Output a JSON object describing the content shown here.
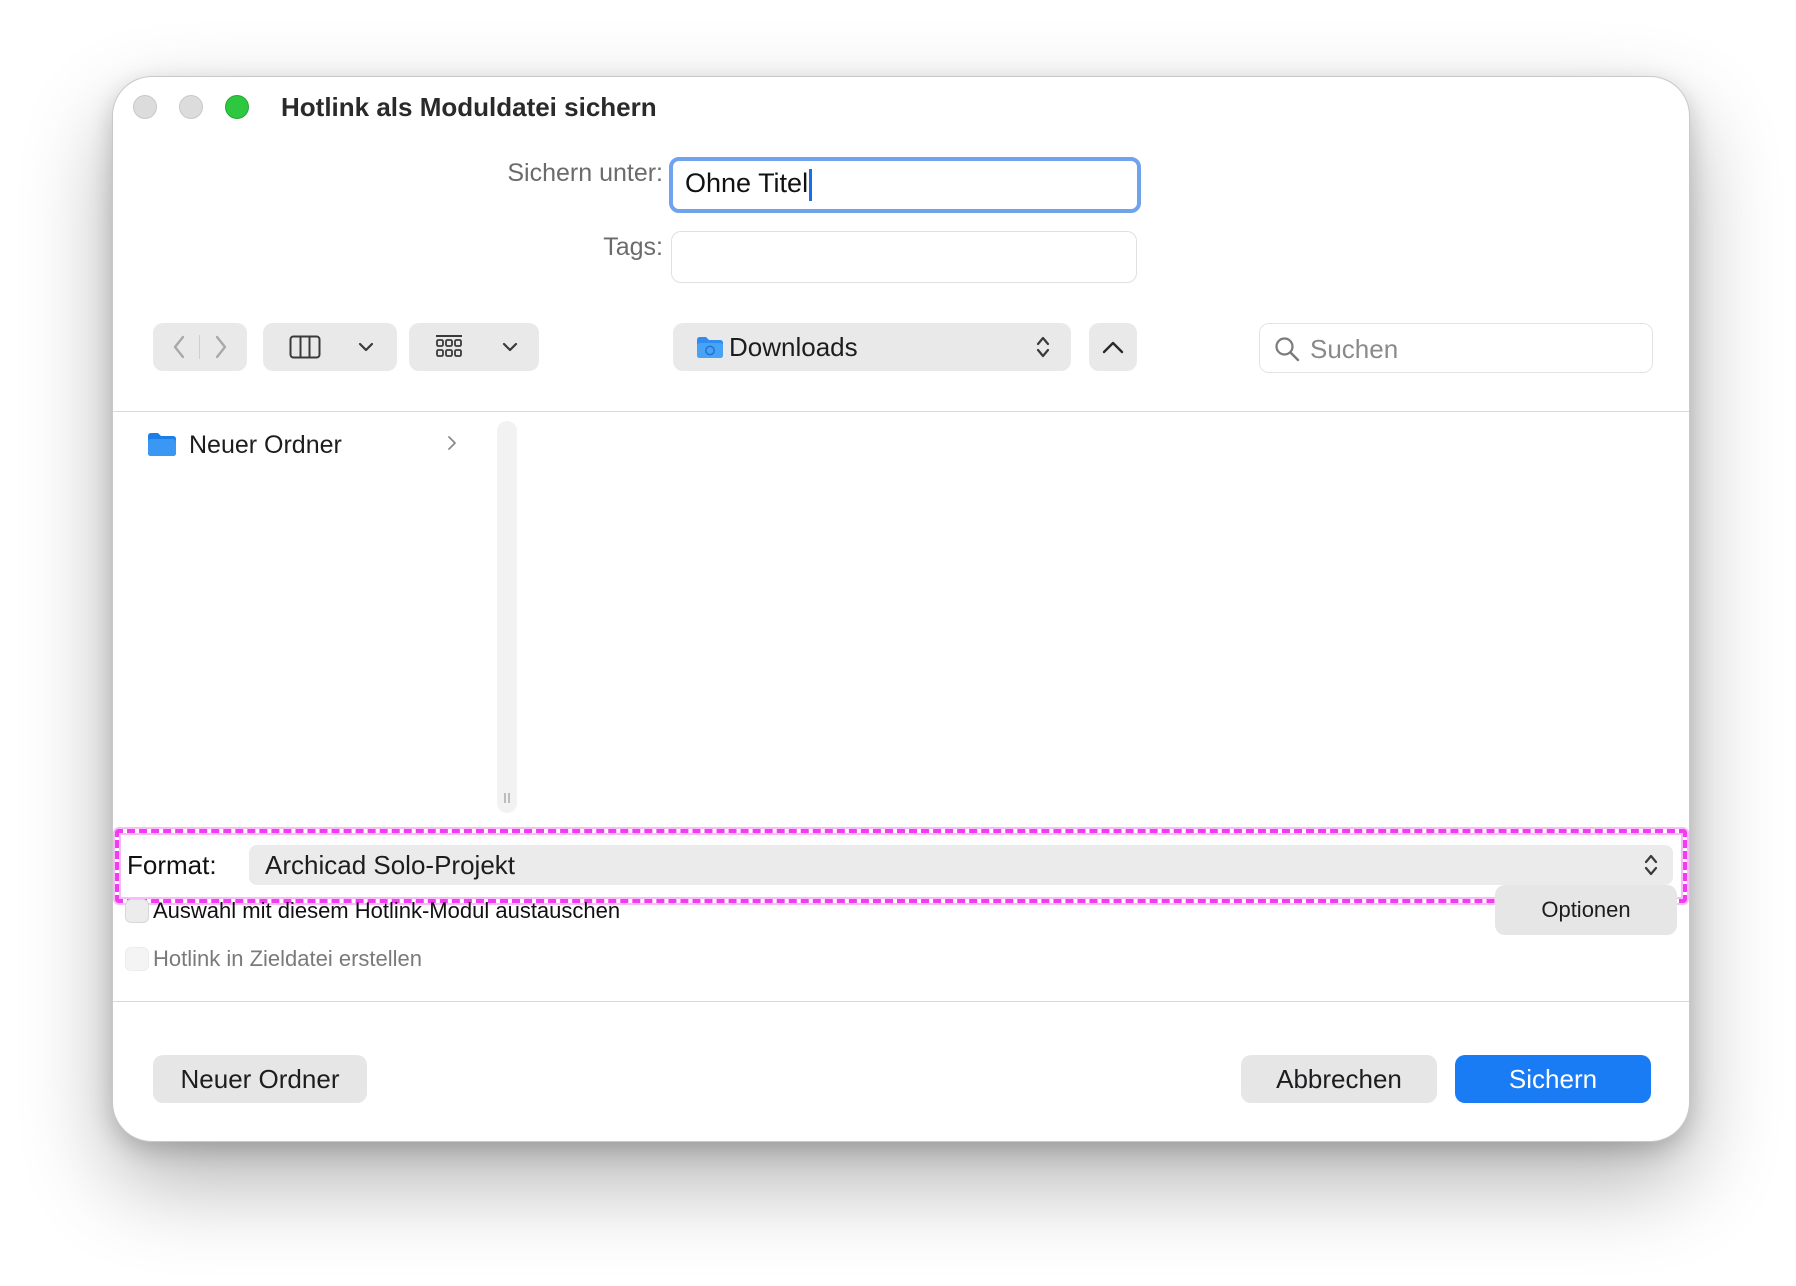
{
  "window": {
    "title": "Hotlink als Moduldatei sichern"
  },
  "form": {
    "save_as_label": "Sichern unter:",
    "save_as_value": "Ohne Titel",
    "tags_label": "Tags:",
    "tags_value": ""
  },
  "toolbar": {
    "location": "Downloads",
    "search_placeholder": "Suchen"
  },
  "browser": {
    "items": [
      {
        "label": "Neuer Ordner"
      }
    ]
  },
  "format": {
    "label": "Format:",
    "value": "Archicad Solo-Projekt"
  },
  "options": {
    "replace_label": "Auswahl mit diesem Hotlink-Modul austauschen",
    "replace_checked": false,
    "hotlink_label": "Hotlink in Zieldatei erstellen",
    "hotlink_checked": false,
    "hotlink_enabled": false,
    "options_button": "Optionen"
  },
  "footer": {
    "new_folder": "Neuer Ordner",
    "cancel": "Abbrechen",
    "save": "Sichern"
  },
  "colors": {
    "accent": "#1a7cf5",
    "focus_ring": "#6fa3ec",
    "highlight": "#f13cf1",
    "zoom_light": "#2ec840"
  }
}
